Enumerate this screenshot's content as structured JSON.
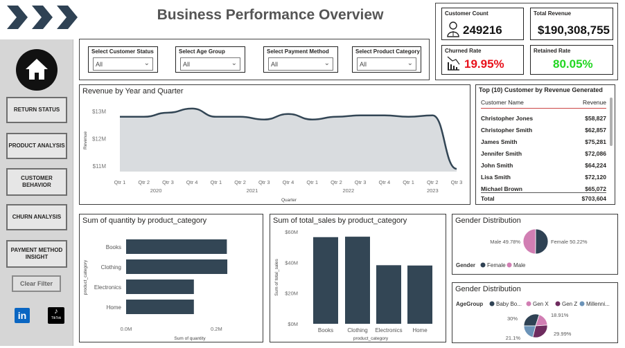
{
  "page": {
    "title": "Business Performance Overview"
  },
  "filters": [
    {
      "label": "Select Customer Status",
      "value": "All"
    },
    {
      "label": "Select Age Group",
      "value": "All"
    },
    {
      "label": "Select Payment Method",
      "value": "All"
    },
    {
      "label": "Select Product Category",
      "value": "All"
    }
  ],
  "kpis": {
    "customer_count": {
      "label": "Customer Count",
      "value": "249216"
    },
    "total_revenue": {
      "label": "Total Revenue",
      "value": "$190,308,755"
    },
    "churned_rate": {
      "label": "Churned Rate",
      "value": "19.95%",
      "color": "#e8101a"
    },
    "retained_rate": {
      "label": "Retained Rate",
      "value": "80.05%",
      "color": "#22d622"
    }
  },
  "sidebar": {
    "items": [
      {
        "label": "RETURN STATUS"
      },
      {
        "label": "PRODUCT ANALYSIS"
      },
      {
        "label": "CUSTOMER BEHAVIOR"
      },
      {
        "label": "CHURN ANALYSIS"
      },
      {
        "label": "PAYMENT METHOD INSIGHT"
      }
    ],
    "clear_filter": "Clear Filter",
    "tiktok_label": "TikTok"
  },
  "top_customers": {
    "title": "Top (10) Customer by Revenue Generated",
    "headers": [
      "Customer Name",
      "Revenue"
    ],
    "rows": [
      [
        "Christopher Jones",
        "$58,827"
      ],
      [
        "Christopher Smith",
        "$62,857"
      ],
      [
        "James Smith",
        "$75,281"
      ],
      [
        "Jennifer Smith",
        "$72,086"
      ],
      [
        "John Smith",
        "$64,224"
      ],
      [
        "Lisa Smith",
        "$72,120"
      ],
      [
        "Michael Brown",
        "$65,072"
      ]
    ],
    "total_label": "Total",
    "total_value": "$703,604"
  },
  "chart_data": [
    {
      "id": "revenue_line",
      "type": "area",
      "title": "Revenue by Year and Quarter",
      "xlabel": "Quarter",
      "ylabel": "Revenue",
      "categories": [
        "Qtr 1",
        "Qtr 2",
        "Qtr 3",
        "Qtr 4",
        "Qtr 1",
        "Qtr 2",
        "Qtr 3",
        "Qtr 4",
        "Qtr 1",
        "Qtr 2",
        "Qtr 3",
        "Qtr 4",
        "Qtr 1",
        "Qtr 2",
        "Qtr 3"
      ],
      "years": [
        {
          "label": "2020",
          "from": 0,
          "to": 3
        },
        {
          "label": "2021",
          "from": 4,
          "to": 7
        },
        {
          "label": "2022",
          "from": 8,
          "to": 11
        },
        {
          "label": "2023",
          "from": 12,
          "to": 14
        }
      ],
      "values": [
        12.8,
        12.8,
        12.95,
        13.1,
        12.8,
        12.8,
        12.7,
        12.9,
        12.7,
        12.8,
        12.85,
        12.85,
        12.8,
        12.85,
        10.9
      ],
      "yticks": [
        "$11M",
        "$12M",
        "$13M"
      ],
      "ytick_values": [
        11,
        12,
        13
      ],
      "ylim": [
        10.8,
        13.4
      ],
      "line_color": "#334655",
      "fill_color": "#d9dcdf"
    },
    {
      "id": "quantity_bar",
      "type": "bar",
      "orientation": "horizontal",
      "title": "Sum of quantity by product_category",
      "xlabel": "Sum of quantity",
      "ylabel": "product_category",
      "categories": [
        "Books",
        "Clothing",
        "Electronics",
        "Home"
      ],
      "values": [
        0.223,
        0.224,
        0.15,
        0.15
      ],
      "xticks": [
        "0.0M",
        "0.2M"
      ],
      "xtick_values": [
        0,
        0.2
      ],
      "xlim": [
        0,
        0.25
      ],
      "color": "#334655"
    },
    {
      "id": "sales_bar",
      "type": "bar",
      "title": "Sum of total_sales by product_category",
      "xlabel": "product_category",
      "ylabel": "Sum of total_sales",
      "categories": [
        "Books",
        "Clothing",
        "Electronics",
        "Home"
      ],
      "values": [
        56.5,
        56.8,
        38.2,
        38.0
      ],
      "yticks": [
        "$0M",
        "$20M",
        "$40M",
        "$60M"
      ],
      "ytick_values": [
        0,
        20,
        40,
        60
      ],
      "ylim": [
        0,
        60
      ],
      "color": "#334655"
    },
    {
      "id": "gender_pie",
      "type": "pie",
      "title": "Gender Distribution",
      "legend_title": "Gender",
      "slices": [
        {
          "name": "Female",
          "value": 50.22,
          "label": "Female 50.22%",
          "color": "#2f4254"
        },
        {
          "name": "Male",
          "value": 49.78,
          "label": "Male 49.78%",
          "color": "#d17eb3"
        }
      ]
    },
    {
      "id": "age_pie",
      "type": "pie",
      "title": "Gender Distribution",
      "legend_title": "AgeGroup",
      "legend_names": [
        "Baby Bo...",
        "Gen X",
        "Gen Z",
        "Millenni..."
      ],
      "slices": [
        {
          "name": "Baby Boomers",
          "value": 30,
          "label": "30%",
          "color": "#2f4254"
        },
        {
          "name": "Gen X",
          "value": 18.91,
          "label": "18.91%",
          "color": "#d17eb3"
        },
        {
          "name": "Gen Z",
          "value": 29.99,
          "label": "29.99%",
          "color": "#6e2b5e"
        },
        {
          "name": "Millennials",
          "value": 21.1,
          "label": "21.1%",
          "color": "#6b93b8"
        }
      ]
    }
  ]
}
